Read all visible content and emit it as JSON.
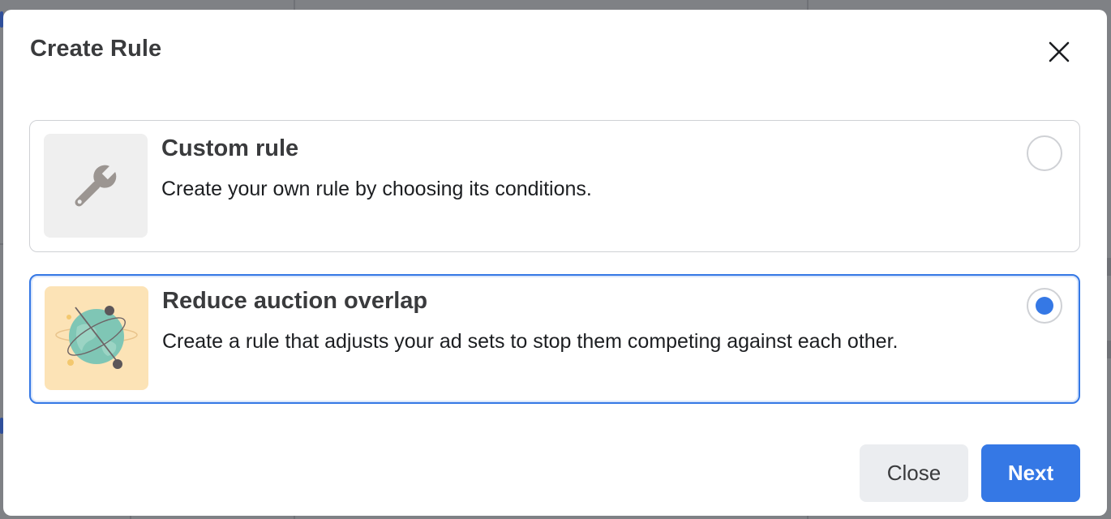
{
  "modal": {
    "title": "Create Rule",
    "close_icon": "close-icon"
  },
  "options": [
    {
      "title": "Custom rule",
      "description": "Create your own rule by choosing its conditions.",
      "icon": "wrench-icon",
      "selected": false
    },
    {
      "title": "Reduce auction overlap",
      "description": "Create a rule that adjusts your ad sets to stop them competing against each other.",
      "icon": "globe-orbit-icon",
      "selected": true
    }
  ],
  "footer": {
    "close_label": "Close",
    "next_label": "Next"
  },
  "colors": {
    "accent": "#3578e5",
    "selected_border": "#3578e5",
    "close_button_bg": "#ebedf0"
  }
}
